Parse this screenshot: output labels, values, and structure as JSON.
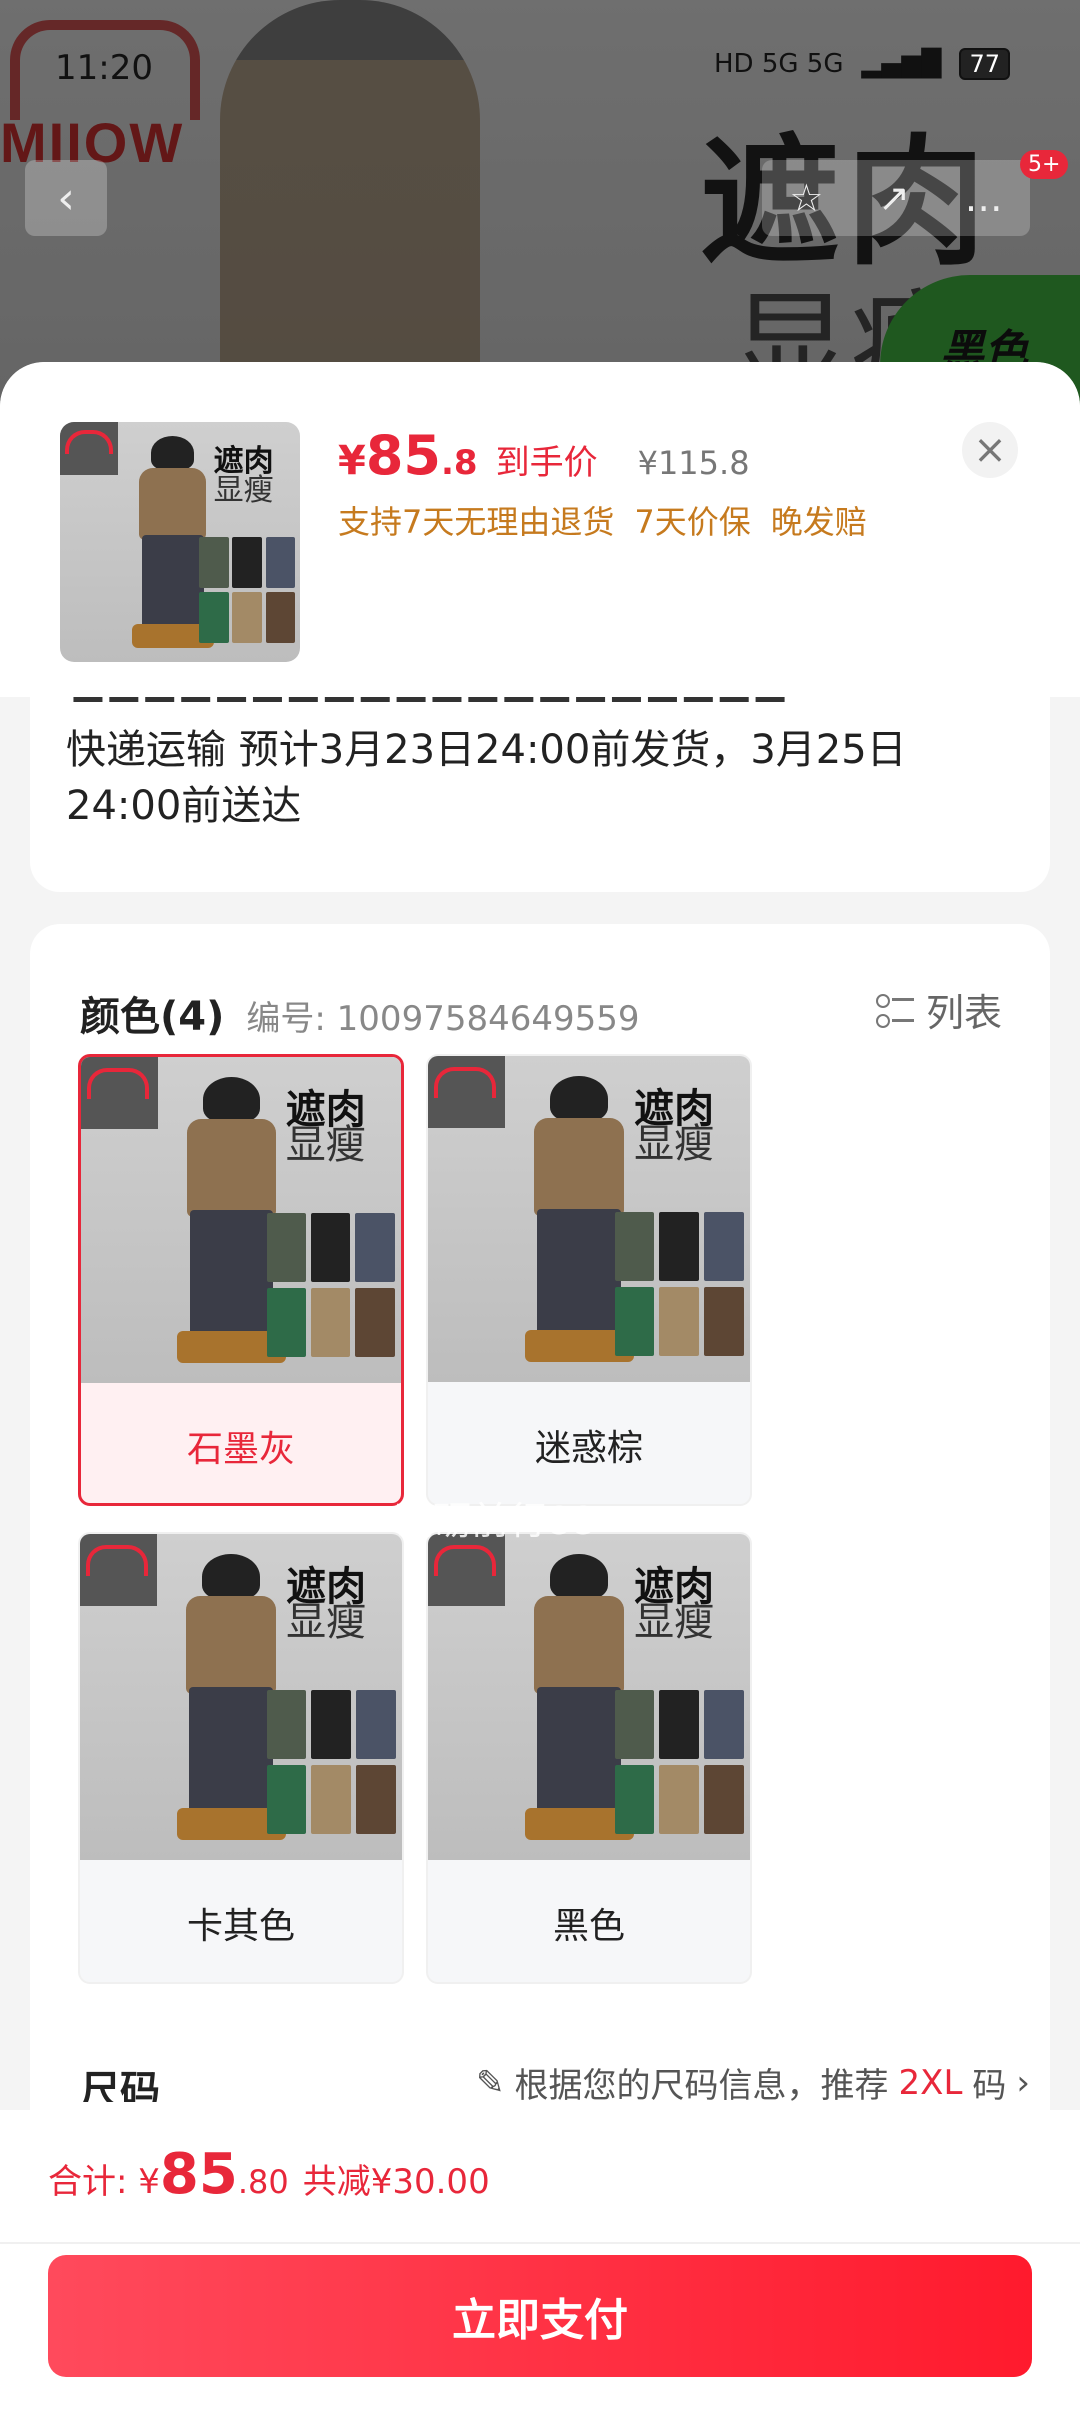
{
  "status_bar": {
    "time": "11:20",
    "network": "HD 5G 5G",
    "battery": "77"
  },
  "background": {
    "logo_text": "MIIOW",
    "ad_text_1": "遮肉",
    "ad_text_2": "显瘦",
    "ad_badge": "黑色"
  },
  "nav": {
    "back_icon": "chevron-left-icon",
    "badge": "5+"
  },
  "sheet": {
    "price_currency": "¥",
    "price_int": "85",
    "price_dec": ".8",
    "price_tag": "到手价",
    "price_original": "¥115.8",
    "promises": [
      "支持7天无理由退货",
      "7天价保",
      "晚发赔"
    ],
    "close_icon": "close-icon",
    "thumb_text_1": "遮肉",
    "thumb_text_2": "显瘦"
  },
  "delivery": {
    "text": "快递运输 预计3月23日24:00前发货，3月25日24:00前送达"
  },
  "spec": {
    "title": "颜色(4)",
    "code": "编号: 10097584649559",
    "list_label": "列表",
    "options": [
      {
        "label": "石墨灰",
        "selected": true
      },
      {
        "label": "迷惑棕",
        "selected": false
      },
      {
        "label": "卡其色",
        "selected": false
      },
      {
        "label": "黑色",
        "selected": false
      }
    ],
    "image_text_1": "遮肉",
    "image_text_2": "显瘦"
  },
  "watermark": "砥砺前行88",
  "size": {
    "title": "尺码",
    "rec_prefix": "根据您的尺码信息，推荐",
    "rec_size": "2XL",
    "rec_suffix": "码"
  },
  "footer": {
    "total_label": "合计: ¥",
    "total_int": "85",
    "total_dec": ".80",
    "discount": "共减¥30.00",
    "pay_label": "立即支付"
  },
  "colors": {
    "accent": "#e8273a",
    "promise": "#c67a1e"
  }
}
